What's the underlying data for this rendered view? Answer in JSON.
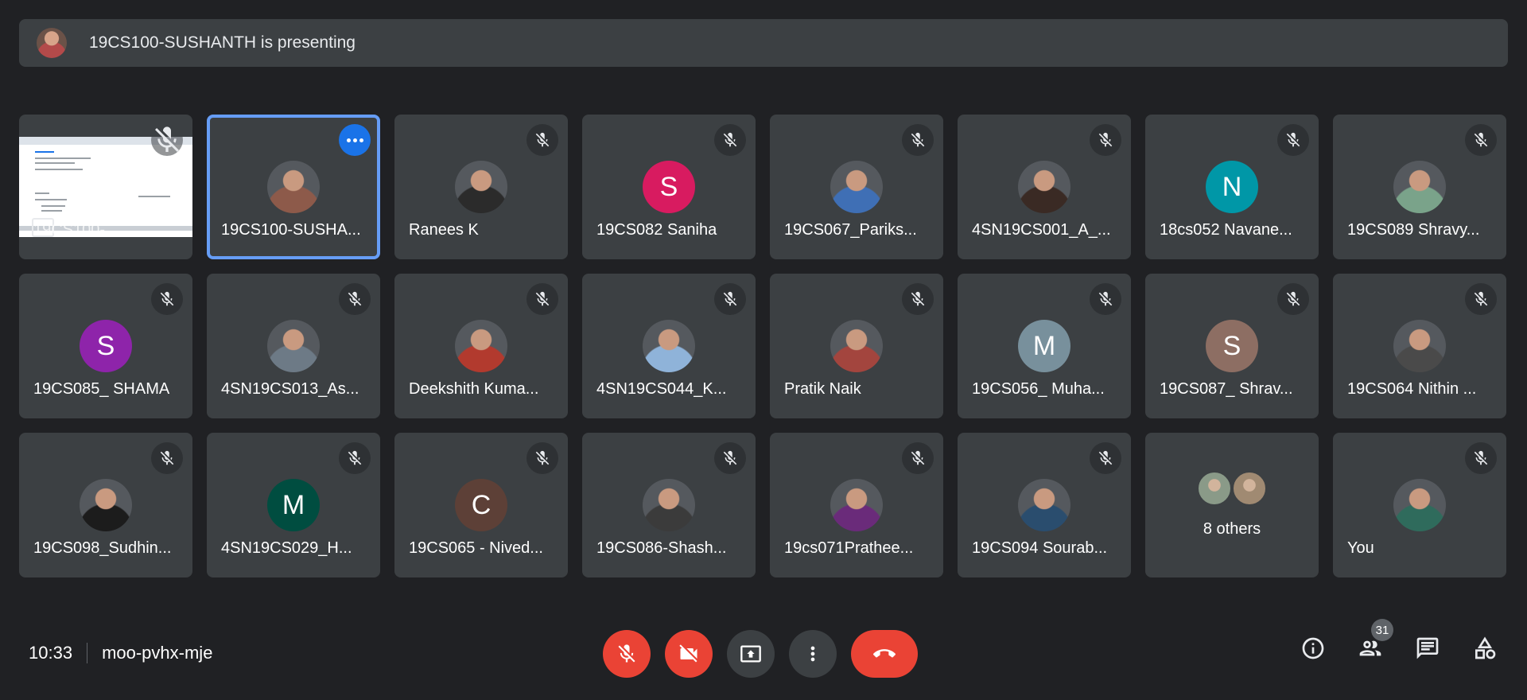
{
  "banner": {
    "presenting_text": "19CS100-SUSHANTH is presenting"
  },
  "screen_share": {
    "label": "19CS100-"
  },
  "participants": [
    {
      "name": "19CS100-SUSHA...",
      "avatar_type": "photo",
      "avatar_color": "#8d5a4a",
      "active": true
    },
    {
      "name": "Ranees K",
      "avatar_type": "photo",
      "avatar_color": "#2b2b2b"
    },
    {
      "name": "19CS082 Saniha",
      "avatar_type": "letter",
      "letter": "S",
      "avatar_color": "#d81b60"
    },
    {
      "name": "19CS067_Pariks...",
      "avatar_type": "photo",
      "avatar_color": "#3f6fb5"
    },
    {
      "name": "4SN19CS001_A_...",
      "avatar_type": "photo",
      "avatar_color": "#3a2a24"
    },
    {
      "name": "18cs052 Navane...",
      "avatar_type": "letter",
      "letter": "N",
      "avatar_color": "#0097a7"
    },
    {
      "name": "19CS089 Shravy...",
      "avatar_type": "photo",
      "avatar_color": "#7aa38a"
    },
    {
      "name": "19CS085_ SHAMA",
      "avatar_type": "letter",
      "letter": "S",
      "avatar_color": "#8e24aa"
    },
    {
      "name": "4SN19CS013_As...",
      "avatar_type": "photo",
      "avatar_color": "#6d7a86"
    },
    {
      "name": "Deekshith Kuma...",
      "avatar_type": "photo",
      "avatar_color": "#b23a2e"
    },
    {
      "name": "4SN19CS044_K...",
      "avatar_type": "photo",
      "avatar_color": "#8fb3d9"
    },
    {
      "name": "Pratik Naik",
      "avatar_type": "photo",
      "avatar_color": "#a3453e"
    },
    {
      "name": "19CS056_ Muha...",
      "avatar_type": "letter",
      "letter": "M",
      "avatar_color": "#78909c"
    },
    {
      "name": "19CS087_ Shrav...",
      "avatar_type": "letter",
      "letter": "S",
      "avatar_color": "#8d6e63"
    },
    {
      "name": "19CS064 Nithin ...",
      "avatar_type": "photo",
      "avatar_color": "#4a4a4a"
    },
    {
      "name": "19CS098_Sudhin...",
      "avatar_type": "photo",
      "avatar_color": "#1c1c1c"
    },
    {
      "name": "4SN19CS029_H...",
      "avatar_type": "letter",
      "letter": "M",
      "avatar_color": "#004d40"
    },
    {
      "name": "19CS065 - Nived...",
      "avatar_type": "letter",
      "letter": "C",
      "avatar_color": "#5d4037"
    },
    {
      "name": "19CS086-Shash...",
      "avatar_type": "photo",
      "avatar_color": "#3b3b3b"
    },
    {
      "name": "19cs071Prathee...",
      "avatar_type": "photo",
      "avatar_color": "#6a2b7a"
    },
    {
      "name": "19CS094 Sourab...",
      "avatar_type": "photo",
      "avatar_color": "#2a4d6e"
    }
  ],
  "others": {
    "label": "8 others"
  },
  "self": {
    "name": "You",
    "avatar_color": "#2f6b5c"
  },
  "footer": {
    "time": "10:33",
    "meeting_code": "moo-pvhx-mje",
    "participant_count": "31"
  },
  "icons": {
    "mic_off": "mic-off-icon",
    "camera_off": "videocam-off-icon",
    "present": "present-to-all-icon",
    "more": "more-vert-icon",
    "end_call": "call-end-icon",
    "info": "info-icon",
    "people": "people-icon",
    "chat": "chat-icon",
    "activities": "activities-icon"
  },
  "colors": {
    "background": "#202124",
    "tile": "#3c4043",
    "accent_red": "#ea4335",
    "accent_blue": "#1a73e8",
    "active_outline": "#669df6"
  }
}
